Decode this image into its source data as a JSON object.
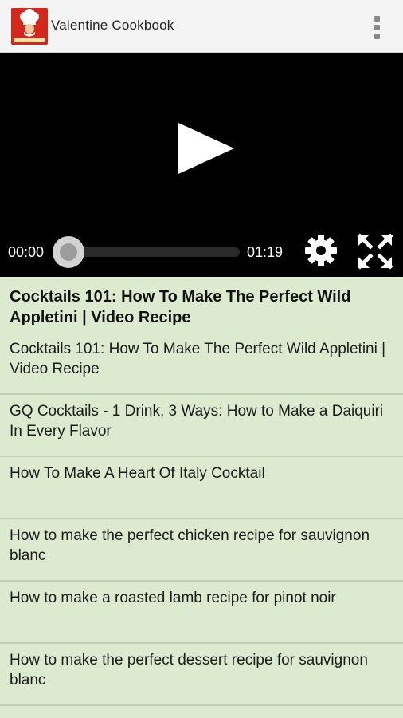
{
  "app": {
    "title": "Valentine Cookbook",
    "logo_text": "Valentine Cookbook",
    "icons": {
      "logo": "chef-hat-icon",
      "overflow": "more-vert-icon"
    },
    "colors": {
      "logo_bg": "#d5281b",
      "list_bg": "#dcebcf"
    }
  },
  "player": {
    "current_time": "00:00",
    "duration": "01:19",
    "progress": 0,
    "icons": {
      "play": "play-icon",
      "settings": "gear-icon",
      "fullscreen": "fullscreen-icon"
    }
  },
  "video_title": "Cocktails 101: How To Make The Perfect Wild Appletini | Video Recipe",
  "videos": [
    {
      "title": "Cocktails 101: How To Make The Perfect Wild Appletini | Video Recipe"
    },
    {
      "title": "GQ Cocktails - 1 Drink, 3 Ways: How to Make a Daiquiri In Every Flavor"
    },
    {
      "title": "How To Make A Heart Of Italy Cocktail"
    },
    {
      "title": "How to make the perfect chicken recipe for sauvignon blanc"
    },
    {
      "title": "How to make a roasted lamb recipe for pinot noir"
    },
    {
      "title": "How to make the perfect dessert recipe for sauvignon blanc"
    }
  ]
}
